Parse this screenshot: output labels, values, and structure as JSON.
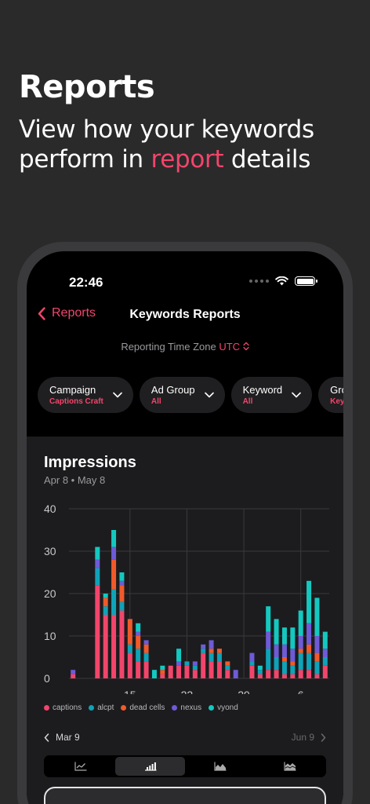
{
  "promo": {
    "title": "Reports",
    "subtitle_pre": "View how your keywords perform in ",
    "subtitle_accent": "report",
    "subtitle_post": " details"
  },
  "status": {
    "time": "22:46"
  },
  "nav": {
    "back_label": "Reports",
    "title": "Keywords Reports"
  },
  "timezone": {
    "label": "Reporting Time Zone",
    "value": "UTC"
  },
  "filters": [
    {
      "label": "Campaign",
      "value": "Captions Craft"
    },
    {
      "label": "Ad Group",
      "value": "All"
    },
    {
      "label": "Keyword",
      "value": "All"
    },
    {
      "label": "Group",
      "value": "Keywor"
    }
  ],
  "impressions": {
    "title": "Impressions",
    "range": "Apr 8 • May 8"
  },
  "range_nav": {
    "start": "Mar 9",
    "end": "Jun 9"
  },
  "colors": {
    "accent": "#f2456b",
    "captions": "#f2456b",
    "alcpt": "#0fa3b8",
    "dead_cells": "#f05a2a",
    "nexus": "#6e5bd6",
    "vyond": "#14c8c0"
  },
  "chart_data": {
    "type": "bar",
    "stacked": true,
    "ylim": [
      0,
      40
    ],
    "yticks": [
      0,
      10,
      20,
      30,
      40
    ],
    "xtick_labels": [
      {
        "index": 7,
        "label": "15"
      },
      {
        "index": 14,
        "label": "22"
      },
      {
        "index": 21,
        "label": "29"
      },
      {
        "index": 28,
        "label": "6"
      }
    ],
    "grid": true,
    "legend_position": "bottom-left",
    "series": [
      {
        "name": "captions",
        "color": "#f2456b",
        "values": [
          1,
          0,
          0,
          22,
          15,
          15,
          16,
          6,
          4,
          4,
          0,
          1,
          3,
          3,
          3,
          2,
          6,
          4,
          4,
          2,
          0,
          0,
          3,
          1,
          2,
          2,
          1,
          1,
          2,
          2,
          1,
          3
        ]
      },
      {
        "name": "alcpt",
        "color": "#0fa3b8",
        "values": [
          0,
          0,
          0,
          4,
          2,
          6,
          2,
          2,
          3,
          2,
          0,
          0,
          0,
          0,
          1,
          1,
          1,
          2,
          2,
          1,
          0,
          0,
          1,
          1,
          5,
          3,
          3,
          2,
          4,
          4,
          3,
          2
        ]
      },
      {
        "name": "dead cells",
        "color": "#f05a2a",
        "values": [
          0,
          0,
          0,
          0,
          2,
          7,
          4,
          6,
          3,
          2,
          0,
          1,
          0,
          0,
          0,
          0,
          0,
          1,
          1,
          1,
          0,
          0,
          0,
          0,
          0,
          0,
          1,
          1,
          1,
          2,
          2,
          0
        ]
      },
      {
        "name": "nexus",
        "color": "#6e5bd6",
        "values": [
          1,
          0,
          0,
          2,
          0,
          3,
          1,
          0,
          1,
          1,
          0,
          0,
          0,
          1,
          0,
          1,
          1,
          2,
          0,
          0,
          2,
          0,
          2,
          0,
          4,
          3,
          3,
          3,
          3,
          5,
          4,
          2
        ]
      },
      {
        "name": "vyond",
        "color": "#14c8c0",
        "values": [
          0,
          0,
          0,
          3,
          1,
          4,
          2,
          0,
          2,
          0,
          2,
          1,
          0,
          3,
          0,
          0,
          0,
          0,
          0,
          0,
          0,
          0,
          0,
          1,
          6,
          6,
          4,
          5,
          6,
          10,
          9,
          4
        ]
      }
    ]
  }
}
